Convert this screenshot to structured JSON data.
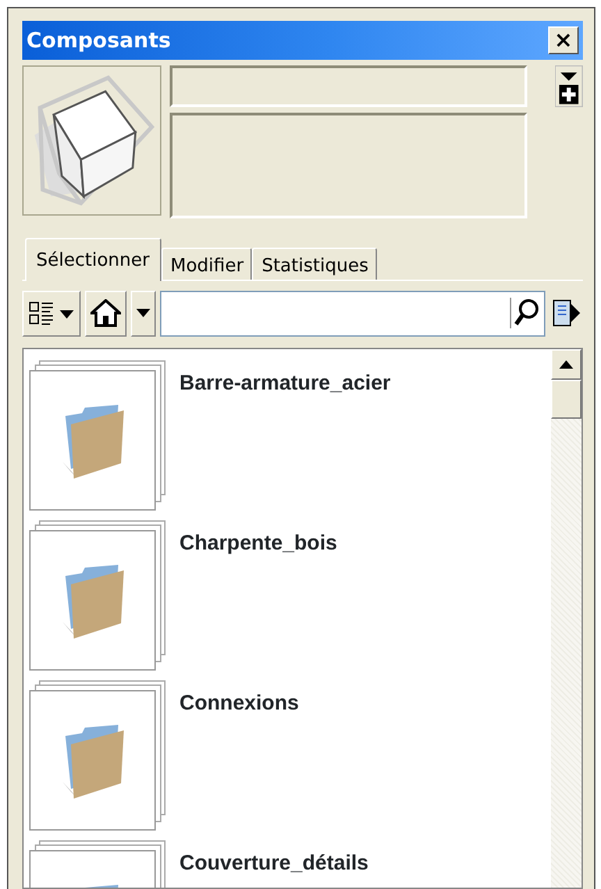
{
  "window": {
    "title": "Composants",
    "close": "×"
  },
  "tabs": [
    {
      "label": "Sélectionner",
      "selected": true
    },
    {
      "label": "Modifier",
      "selected": false
    },
    {
      "label": "Statistiques",
      "selected": false
    }
  ],
  "items": [
    {
      "name": "Barre-armature_acier"
    },
    {
      "name": "Charpente_bois"
    },
    {
      "name": "Connexions"
    },
    {
      "name": "Couverture_détails"
    }
  ]
}
